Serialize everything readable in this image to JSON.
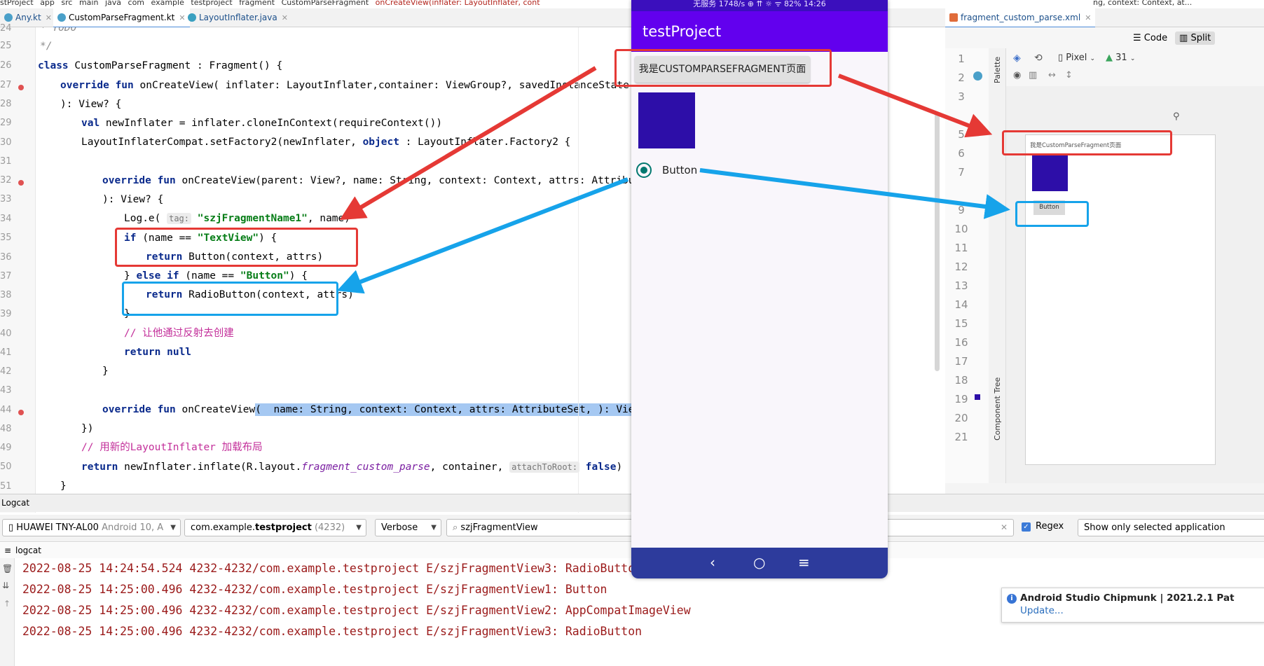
{
  "colors": {
    "accent_red": "#e53935",
    "accent_blue": "#16a3ea",
    "app_bar": "#6200ee",
    "image_fill": "#2d0ea8",
    "log_text": "#9b1a1a",
    "nav_bar": "#2d3b9c"
  },
  "breadcrumb": [
    "stProject",
    "app",
    "src",
    "main",
    "java",
    "com",
    "example",
    "testproject",
    "fragment",
    "CustomParseFragment",
    "onCreateView(inflater: LayoutInflater, cont",
    "ng, context: Context, at..."
  ],
  "tabs": [
    {
      "label": "Any.kt"
    },
    {
      "label": "CustomParseFragment.kt"
    },
    {
      "label": "LayoutInflater.java"
    }
  ],
  "xml_tab": {
    "label": "fragment_custom_parse.xml"
  },
  "editor": {
    "line_numbers": [
      "24",
      "25",
      "26",
      "27",
      "28",
      "29",
      "30",
      "31",
      "32",
      "33",
      "34",
      "35",
      "36",
      "37",
      "38",
      "39",
      "40",
      "41",
      "42",
      "43",
      "44",
      "48",
      "49",
      "50",
      "51"
    ],
    "lines": {
      "l24": "* TODO",
      "l25": "*/",
      "l26_kw": "class",
      "l26_rest": " CustomParseFragment : Fragment() {",
      "l27_kw": "override fun",
      "l27_rest": " onCreateView( inflater: LayoutInflater,container: ViewGroup?, savedInstanceState: Bundle?,",
      "l28": "): View? {",
      "l29_kw": "val",
      "l29_rest": " newInflater = inflater.cloneInContext(requireContext())",
      "l30_a": "LayoutInflaterCompat.setFactory2(newInflater, ",
      "l30_kw": "object",
      "l30_b": " : LayoutInflater.Factory2 {",
      "l32_kw": "override fun",
      "l32_rest": " onCreateView(parent: View?, name: String, context: Context, attrs: AttributeSet,",
      "l33": "): View? {",
      "l34_a": "Log.e( ",
      "l34_hint": "tag:",
      "l34_str": "\"szjFragmentName1\"",
      "l34_b": ", name)",
      "l35_kw": "if",
      "l35_a": " (name == ",
      "l35_str": "\"TextView\"",
      "l35_b": ") {",
      "l36_kw": "return",
      "l36_rest": " Button(context, attrs)",
      "l37_a": "} ",
      "l37_kw": "else if",
      "l37_b": " (name == ",
      "l37_str": "\"Button\"",
      "l37_c": ") {",
      "l38_kw": "return",
      "l38_rest": " RadioButton(context, attrs)",
      "l39": "}",
      "l40": "// 让他通过反射去创建",
      "l41": "return null",
      "l42": "}",
      "l44_kw": "override fun",
      "l44_a": " onCreateView",
      "l44_b": "(  name: String, context: Context, attrs: AttributeSet, ",
      "l44_c": "): View? ",
      "l44_d": "{...}",
      "l48": "})",
      "l49": "// 用新的LayoutInflater 加载布局",
      "l50_kw": "return",
      "l50_a": " newInflater.inflate(R.layout.",
      "l50_it": "fragment_custom_parse",
      "l50_b": ", container, ",
      "l50_hint": "attachToRoot:",
      "l50_kw2": "false",
      "l50_c": ")",
      "l51": "}"
    }
  },
  "phone": {
    "status": "无服务  1748/s  ⊕ ⇈      ☼ ᯤ 82%  14:26",
    "app_title": "testProject",
    "text_button": "我是CUSTOMPARSEFRAGMENT页面",
    "radio_label": "Button",
    "nav_back": "‹",
    "nav_home": "○",
    "nav_menu": "≡"
  },
  "preview": {
    "code_label": "Code",
    "split_label": "Split",
    "device": "Pixel",
    "api": "31",
    "palette_label": "Palette",
    "component_tree_label": "Component Tree",
    "line_numbers": [
      "1",
      "2",
      "3",
      "5",
      "6",
      "7",
      "9",
      "10",
      "11",
      "12",
      "13",
      "14",
      "15",
      "16",
      "17",
      "18",
      "19",
      "20",
      "21"
    ],
    "text": "我是CustomParseFragment页面",
    "button": "Button"
  },
  "logcat": {
    "title": "Logcat",
    "device": "HUAWEI TNY-AL00",
    "device_os": "Android 10, A",
    "process_pkg_a": "com.example.",
    "process_pkg_b": "testproject",
    "process_pid": "(4232)",
    "level": "Verbose",
    "search": "szjFragmentView",
    "regex_label": "Regex",
    "filter": "Show only selected application",
    "sub_label": "logcat",
    "lines": [
      "2022-08-25 14:24:54.524 4232-4232/com.example.testproject E/szjFragmentView3: RadioButton",
      "2022-08-25 14:25:00.496 4232-4232/com.example.testproject E/szjFragmentView1: Button",
      "2022-08-25 14:25:00.496 4232-4232/com.example.testproject E/szjFragmentView2: AppCompatImageView",
      "2022-08-25 14:25:00.496 4232-4232/com.example.testproject E/szjFragmentView3: RadioButton"
    ]
  },
  "notification": {
    "title": "Android Studio Chipmunk | 2021.2.1 Pat",
    "link": "Update..."
  }
}
